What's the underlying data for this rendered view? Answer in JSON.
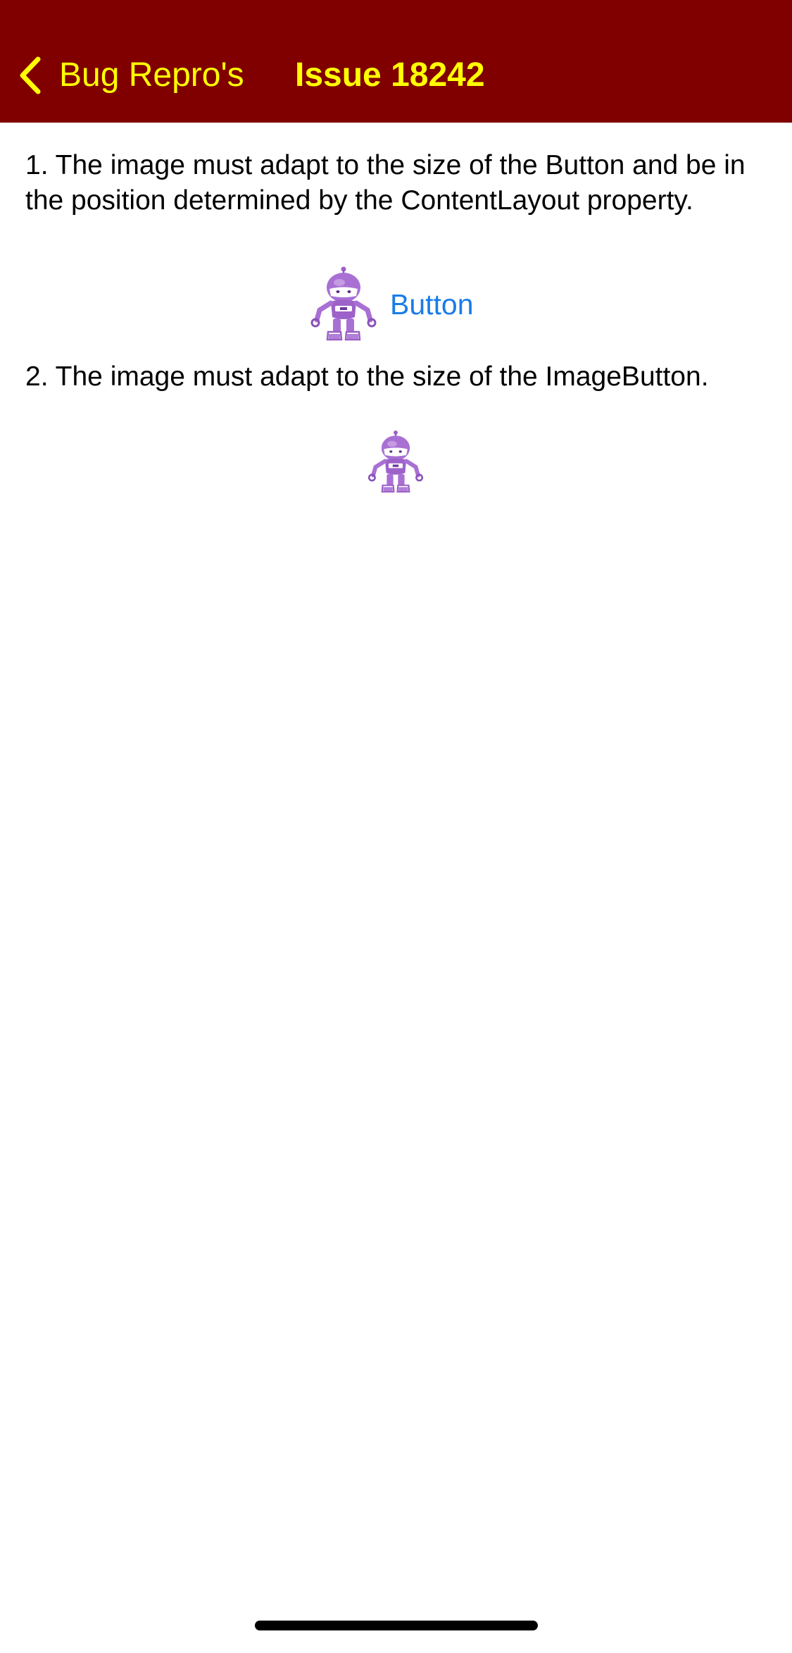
{
  "navbar": {
    "back_label": "Bug Repro's",
    "title": "Issue 18242",
    "background_color": "#800000",
    "foreground_color": "#ffff00"
  },
  "content": {
    "description_1": "1. The image must adapt to the size of the Button and be in the position determined by the ContentLayout property.",
    "button": {
      "label": "Button",
      "image_icon": "dotnet-bot-icon",
      "label_color": "#1a7ce8"
    },
    "description_2": "2. The image must adapt to the size of the ImageButton.",
    "image_button": {
      "image_icon": "dotnet-bot-icon"
    }
  }
}
